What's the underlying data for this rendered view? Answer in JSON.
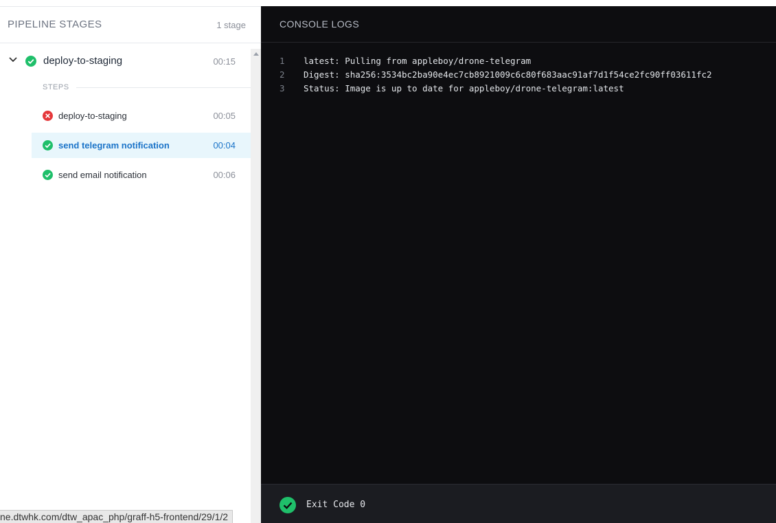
{
  "left_panel": {
    "title": "PIPELINE STAGES",
    "count": "1 stage",
    "stage": {
      "name": "deploy-to-staging",
      "duration": "00:15",
      "status": "success",
      "steps_label": "STEPS",
      "steps": [
        {
          "name": "deploy-to-staging",
          "duration": "00:05",
          "status": "failure",
          "active": false
        },
        {
          "name": "send telegram notification",
          "duration": "00:04",
          "status": "success",
          "active": true
        },
        {
          "name": "send email notification",
          "duration": "00:06",
          "status": "success",
          "active": false
        }
      ]
    }
  },
  "console": {
    "title": "CONSOLE LOGS",
    "lines": [
      {
        "num": "1",
        "text": "latest: Pulling from appleboy/drone-telegram"
      },
      {
        "num": "2",
        "text": "Digest: sha256:3534bc2ba90e4ec7cb8921009c6c80f683aac91af7d1f54ce2fc90ff03611fc2"
      },
      {
        "num": "3",
        "text": "Status: Image is up to date for appleboy/drone-telegram:latest"
      }
    ],
    "exit_code": "Exit Code 0"
  },
  "status_tooltip": {
    "url": "ne.dtwhk.com/dtw_apac_php/graff-h5-frontend/29/1/2"
  },
  "colors": {
    "success": "#1fbf6a",
    "failure": "#e5383b",
    "active_text": "#1a73c8",
    "active_bg": "#e8f6fc",
    "console_bg": "#0d0d10"
  }
}
